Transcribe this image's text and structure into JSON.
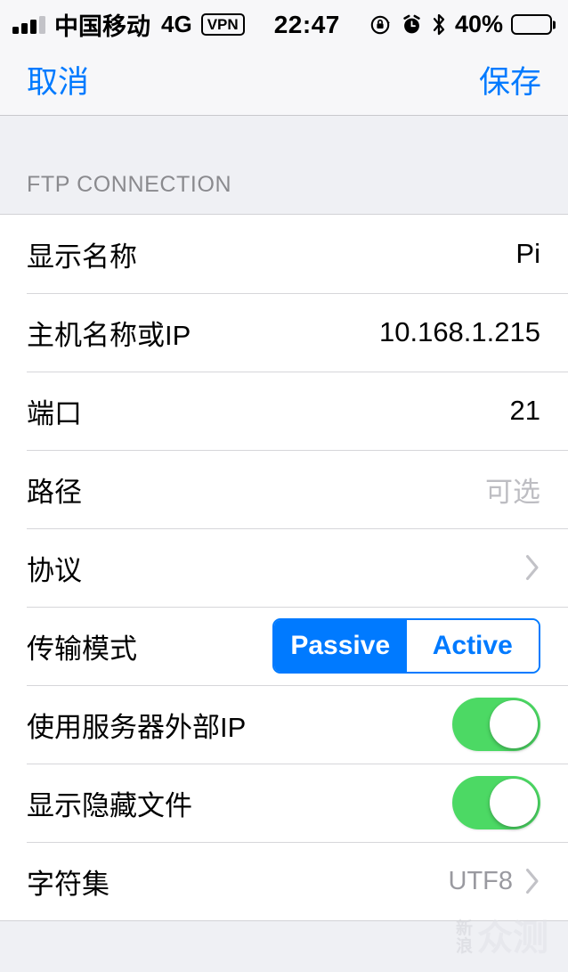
{
  "status_bar": {
    "carrier": "中国移动",
    "network": "4G",
    "vpn_label": "VPN",
    "time": "22:47",
    "battery_percent": "40%",
    "battery_level": 40,
    "signal_bars_filled": 3,
    "signal_bars_total": 4,
    "icons": [
      "rotation-lock-icon",
      "alarm-clock-icon",
      "bluetooth-icon",
      "battery-icon"
    ]
  },
  "navbar": {
    "cancel_label": "取消",
    "save_label": "保存"
  },
  "section": {
    "header": "FTP CONNECTION"
  },
  "rows": {
    "display_name": {
      "label": "显示名称",
      "value": "Pi"
    },
    "hostname": {
      "label": "主机名称或IP",
      "value": "10.168.1.215"
    },
    "port": {
      "label": "端口",
      "value": "21"
    },
    "path": {
      "label": "路径",
      "placeholder": "可选"
    },
    "protocol": {
      "label": "协议",
      "value": ""
    },
    "transfer_mode": {
      "label": "传输模式",
      "options": [
        "Passive",
        "Active"
      ],
      "selected": "Passive"
    },
    "external_ip": {
      "label": "使用服务器外部IP",
      "enabled": true
    },
    "hidden_files": {
      "label": "显示隐藏文件",
      "enabled": true
    },
    "charset": {
      "label": "字符集",
      "value": "UTF8"
    }
  },
  "watermark": {
    "brand_small": "新浪",
    "brand_large": "众测"
  },
  "colors": {
    "accent_blue": "#007aff",
    "toggle_green": "#4cd964",
    "page_bg": "#eff0f4",
    "card_bg": "#ffffff",
    "muted_text": "#bdbdc2",
    "header_text": "#8a8a8e"
  }
}
